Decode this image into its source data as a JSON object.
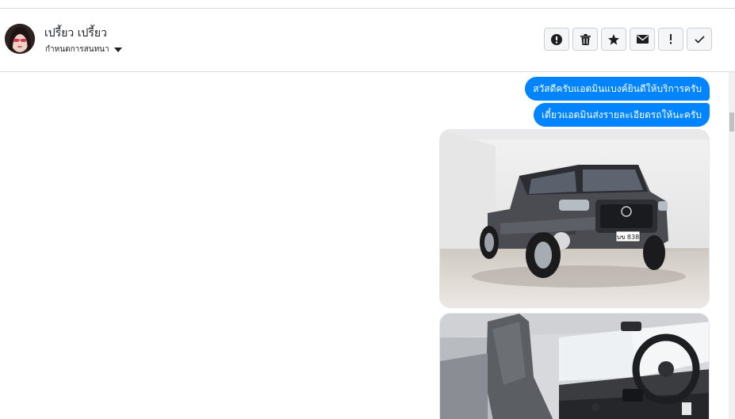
{
  "contact": {
    "name": "เปรี้ยว เปรี้ยว",
    "conversation_label": "กำหนดการสนทนา"
  },
  "toolbar": {
    "buttons": [
      {
        "icon": "alert-circle-icon"
      },
      {
        "icon": "trash-icon"
      },
      {
        "icon": "star-icon"
      },
      {
        "icon": "mail-icon"
      },
      {
        "icon": "exclamation-icon"
      },
      {
        "icon": "check-icon"
      }
    ]
  },
  "messages": [
    {
      "type": "text",
      "text": "สวัสดีครับแอดมินแบงค์ยินดีให้บริการครับ"
    },
    {
      "type": "text",
      "text": "เดี๋ยวแอดมินส่งรายละเอียดรถให้นะครับ"
    },
    {
      "type": "image",
      "plate_text": "บข 838"
    },
    {
      "type": "image"
    }
  ],
  "colors": {
    "bubble": "#0084ff",
    "border": "#dadde1",
    "button_bg": "#f5f6f7"
  }
}
